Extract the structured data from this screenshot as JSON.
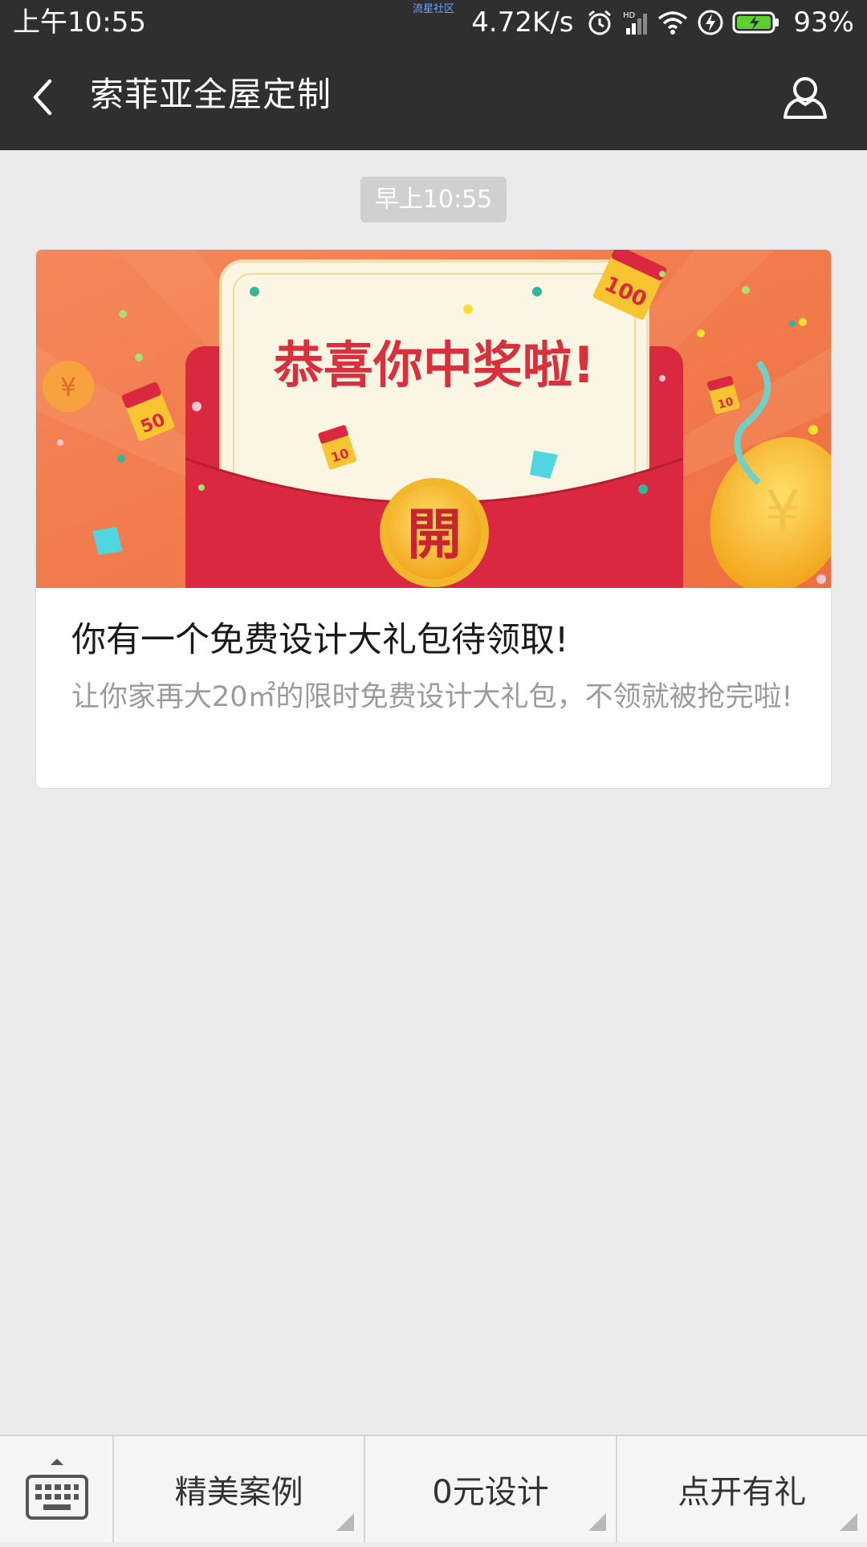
{
  "status_bar": {
    "time": "上午10:55",
    "watermark": "流星社区",
    "network_speed": "4.72K/s",
    "battery_percent": "93%",
    "icons": [
      "alarm-icon",
      "signal-hd-icon",
      "wifi-icon",
      "charging-bolt-icon",
      "battery-icon"
    ]
  },
  "header": {
    "title": "索菲亚全屋定制",
    "back_icon": "chevron-left-icon",
    "profile_icon": "person-icon"
  },
  "chat": {
    "timestamp": "早上10:55",
    "article": {
      "banner": {
        "headline": "恭喜你中奖啦!",
        "open_button": "開",
        "coin_symbol": "¥",
        "envelope_labels": [
          "50",
          "100",
          "10",
          "10"
        ],
        "colors": {
          "background": "#f07a45",
          "envelope_red": "#d9283f",
          "letter": "#fbf5e4",
          "gold": "#f7c531",
          "text_red": "#d8303c"
        }
      },
      "title": "你有一个免费设计大礼包待领取!",
      "description": "让你家再大20㎡的限时免费设计大礼包，不领就被抢完啦!"
    }
  },
  "bottom_menu": {
    "keyboard_icon": "keyboard-icon",
    "items": [
      {
        "label": "精美案例"
      },
      {
        "label": "0元设计"
      },
      {
        "label": "点开有礼"
      }
    ]
  }
}
